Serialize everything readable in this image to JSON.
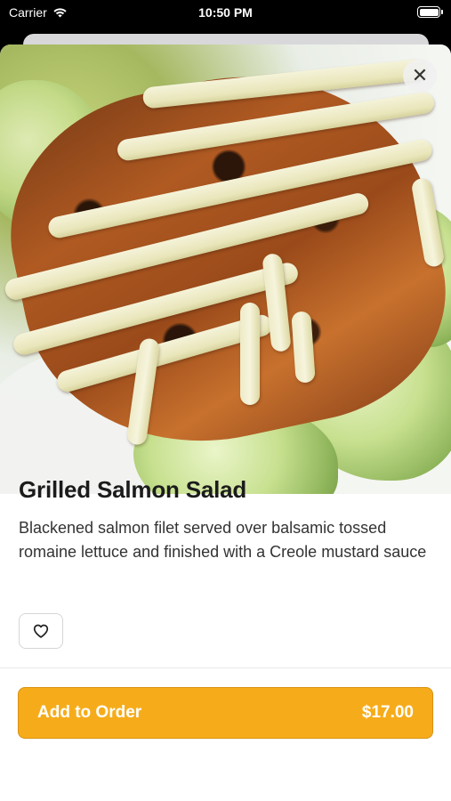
{
  "status_bar": {
    "carrier": "Carrier",
    "time": "10:50 PM",
    "wifi_icon": "wifi-icon",
    "battery_icon": "battery-icon"
  },
  "item": {
    "image_icon": "grilled-salmon-salad-photo",
    "title": "Grilled Salmon Salad",
    "description": "Blackened salmon filet served over balsamic tossed romaine lettuce and finished with a Creole mustard sauce"
  },
  "actions": {
    "close_symbol": "✕",
    "favorite_icon": "heart-icon",
    "add_to_order_label": "Add to Order",
    "price": "$17.00"
  },
  "colors": {
    "accent": "#f6ac1a",
    "text": "#1b1b1b"
  }
}
